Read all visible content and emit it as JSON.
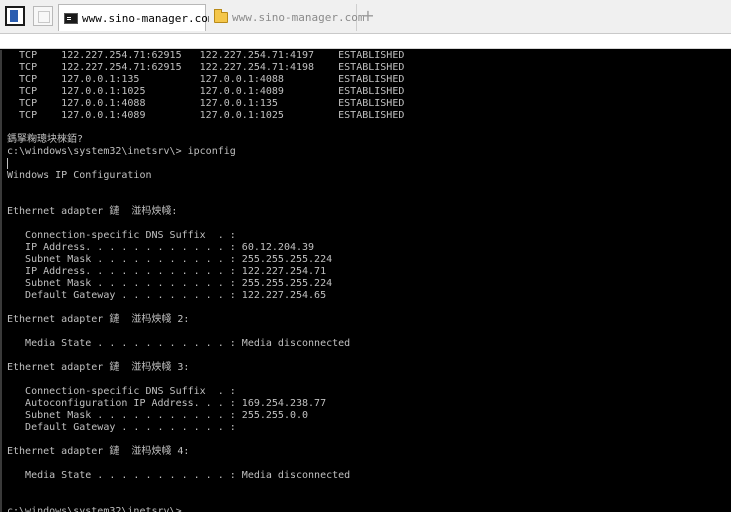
{
  "tabs": [
    {
      "label": "www.sino-manager.com",
      "icon": "console-icon",
      "active": true
    },
    {
      "label": "www.sino-manager.com",
      "icon": "folder-icon",
      "active": false
    }
  ],
  "new_tab_label": "+",
  "terminal": {
    "lines": [
      "  TCP    122.227.254.71:62915   122.227.254.71:4197    ESTABLISHED",
      "  TCP    122.227.254.71:62915   122.227.254.71:4198    ESTABLISHED",
      "  TCP    127.0.0.1:135          127.0.0.1:4088         ESTABLISHED",
      "  TCP    127.0.0.1:1025         127.0.0.1:4089         ESTABLISHED",
      "  TCP    127.0.0.1:4088         127.0.0.1:135          ESTABLISHED",
      "  TCP    127.0.0.1:4089         127.0.0.1:1025         ESTABLISHED",
      "",
      "鎷掔粷璁块棶銆?",
      "c:\\windows\\system32\\inetsrv\\> ipconfig",
      "",
      "Windows IP Configuration",
      "",
      "",
      "Ethernet adapter 鏈  湴杩炴帴:",
      "",
      "   Connection-specific DNS Suffix  . :",
      "   IP Address. . . . . . . . . . . . : 60.12.204.39",
      "   Subnet Mask . . . . . . . . . . . : 255.255.255.224",
      "   IP Address. . . . . . . . . . . . : 122.227.254.71",
      "   Subnet Mask . . . . . . . . . . . : 255.255.255.224",
      "   Default Gateway . . . . . . . . . : 122.227.254.65",
      "",
      "Ethernet adapter 鏈  湴杩炴帴 2:",
      "",
      "   Media State . . . . . . . . . . . : Media disconnected",
      "",
      "Ethernet adapter 鏈  湴杩炴帴 3:",
      "",
      "   Connection-specific DNS Suffix  . :",
      "   Autoconfiguration IP Address. . . : 169.254.238.77",
      "   Subnet Mask . . . . . . . . . . . : 255.255.0.0",
      "   Default Gateway . . . . . . . . . :",
      "",
      "Ethernet adapter 鏈  湴杩炴帴 4:",
      "",
      "   Media State . . . . . . . . . . . : Media disconnected",
      "",
      "",
      "c:\\windows\\system32\\inetsrv\\>"
    ]
  },
  "colors": {
    "terminal_bg": "#000000",
    "terminal_text": "#c0c0c0",
    "tab_strip": "#f0f0f0"
  }
}
